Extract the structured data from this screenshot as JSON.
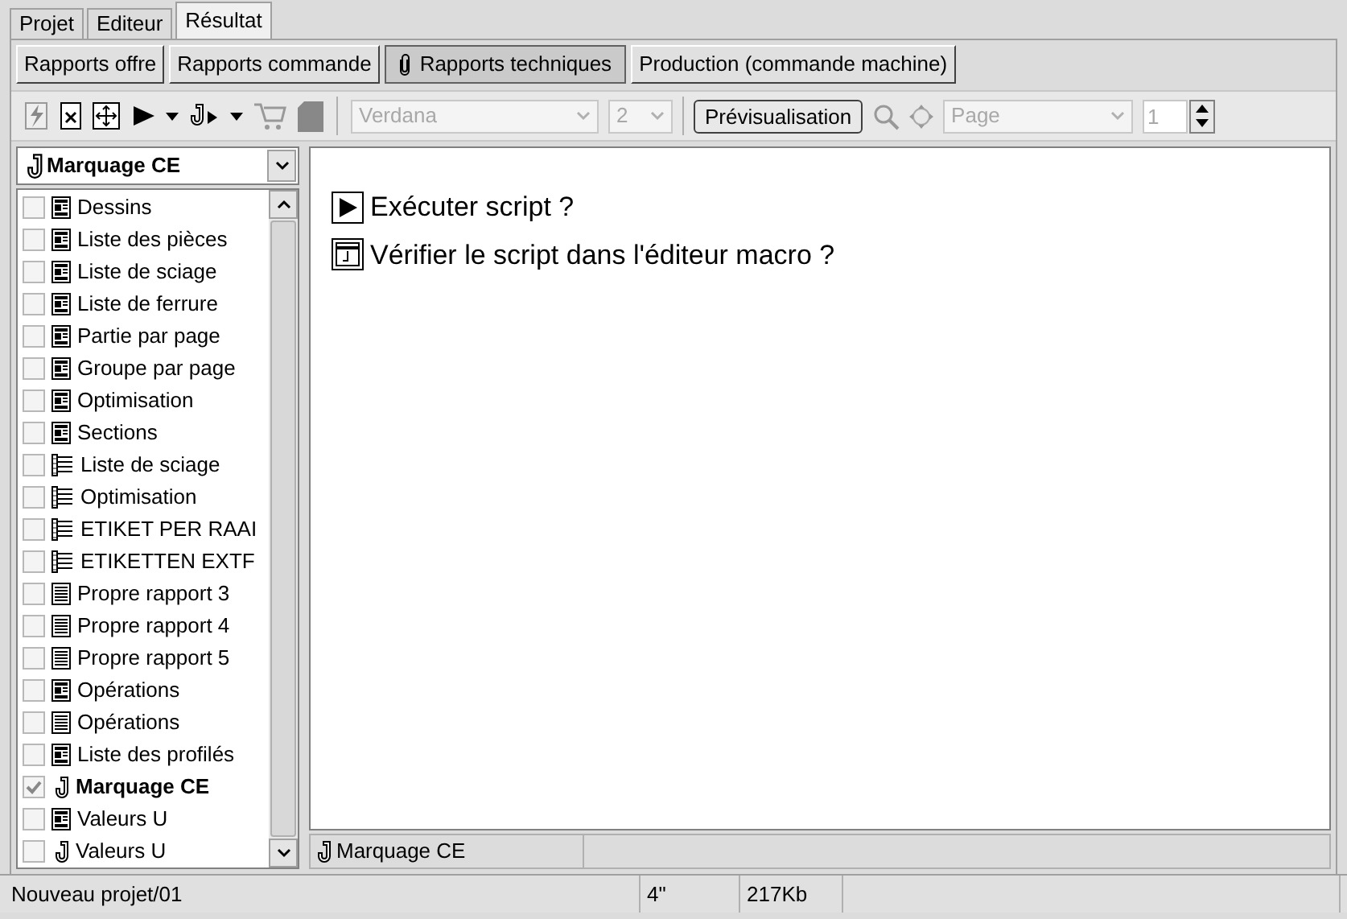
{
  "tabs": [
    {
      "label": "Projet",
      "selected": false
    },
    {
      "label": "Editeur",
      "selected": false
    },
    {
      "label": "Résultat",
      "selected": true
    }
  ],
  "report_tabs": [
    {
      "label": "Rapports offre",
      "selected": false,
      "icon": false
    },
    {
      "label": "Rapports commande",
      "selected": false,
      "icon": false
    },
    {
      "label": "Rapports techniques",
      "selected": true,
      "icon": true
    },
    {
      "label": "Production (commande machine)",
      "selected": false,
      "icon": false
    }
  ],
  "toolbar": {
    "font": "Verdana",
    "size": "2",
    "preview_button": "Prévisualisation",
    "page_mode": "Page",
    "page_number": "1"
  },
  "report_selector": {
    "value": "Marquage CE"
  },
  "reports": [
    {
      "label": "Dessins",
      "kind": "report",
      "checked": false,
      "selected": false
    },
    {
      "label": "Liste des pièces",
      "kind": "report",
      "checked": false,
      "selected": false
    },
    {
      "label": "Liste de sciage",
      "kind": "report",
      "checked": false,
      "selected": false
    },
    {
      "label": "Liste de ferrure",
      "kind": "report",
      "checked": false,
      "selected": false
    },
    {
      "label": "Partie par page",
      "kind": "report",
      "checked": false,
      "selected": false
    },
    {
      "label": "Groupe par page",
      "kind": "report",
      "checked": false,
      "selected": false
    },
    {
      "label": "Optimisation",
      "kind": "report",
      "checked": false,
      "selected": false
    },
    {
      "label": "Sections",
      "kind": "report",
      "checked": false,
      "selected": false
    },
    {
      "label": "Liste de sciage",
      "kind": "list",
      "checked": false,
      "selected": false
    },
    {
      "label": "Optimisation",
      "kind": "list",
      "checked": false,
      "selected": false
    },
    {
      "label": "ETIKET PER RAAI",
      "kind": "list",
      "checked": false,
      "selected": false
    },
    {
      "label": "ETIKETTEN EXTF",
      "kind": "list",
      "checked": false,
      "selected": false
    },
    {
      "label": "Propre rapport 3",
      "kind": "page",
      "checked": false,
      "selected": false
    },
    {
      "label": "Propre rapport 4",
      "kind": "page",
      "checked": false,
      "selected": false
    },
    {
      "label": "Propre rapport 5",
      "kind": "page",
      "checked": false,
      "selected": false
    },
    {
      "label": "Opérations",
      "kind": "report",
      "checked": false,
      "selected": false
    },
    {
      "label": "Opérations",
      "kind": "page",
      "checked": false,
      "selected": false
    },
    {
      "label": "Liste des profilés",
      "kind": "report",
      "checked": false,
      "selected": false
    },
    {
      "label": "Marquage CE",
      "kind": "script",
      "checked": true,
      "selected": true
    },
    {
      "label": "Valeurs U",
      "kind": "report",
      "checked": false,
      "selected": false
    },
    {
      "label": "Valeurs U",
      "kind": "script",
      "checked": false,
      "selected": false
    }
  ],
  "actions": [
    {
      "label": "Exécuter script ?",
      "kind": "run"
    },
    {
      "label": "Vérifier le script dans l'éditeur macro ?",
      "kind": "edit"
    }
  ],
  "content_status": "Marquage CE",
  "status_bar": {
    "project": "Nouveau projet/01",
    "time": "4\"",
    "size": "217Kb"
  }
}
